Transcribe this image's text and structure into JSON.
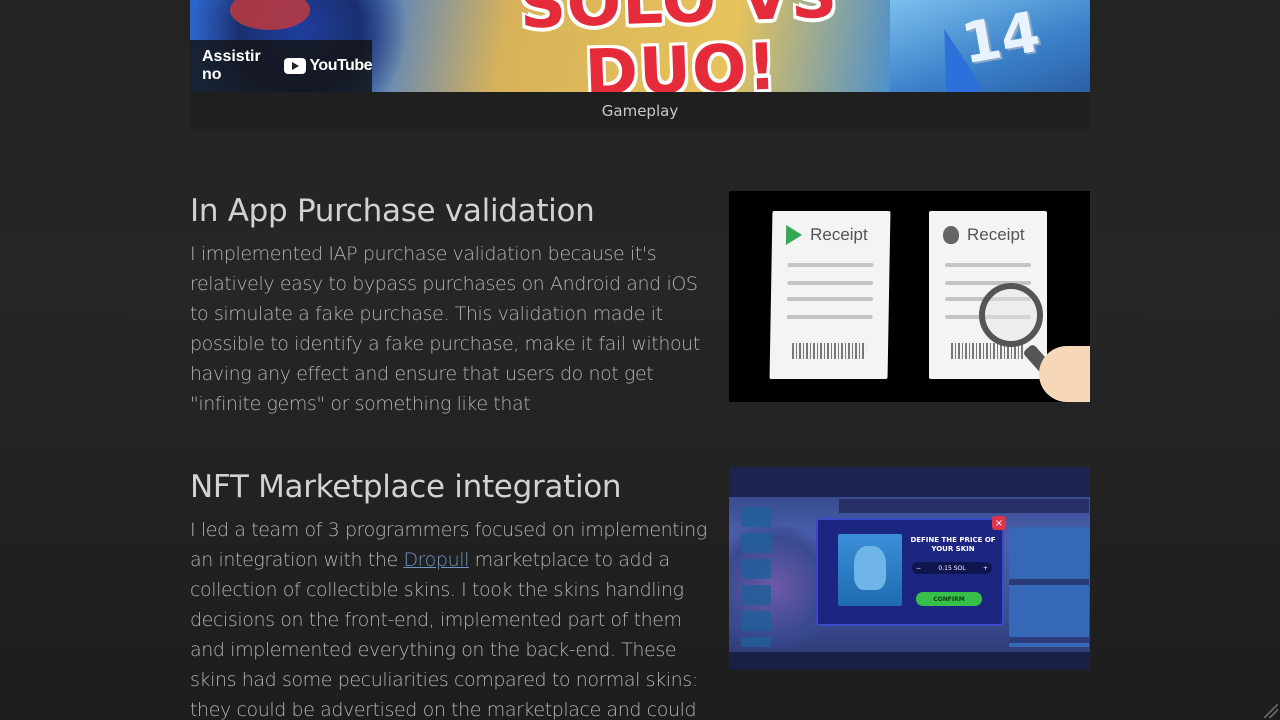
{
  "video": {
    "title_art": "SOLO VS DUO!",
    "watch_label": "Assistir no",
    "platform": "YouTube",
    "caption": "Gameplay",
    "colors": {
      "title_red": "#e52b3a",
      "overlay": "#141414"
    }
  },
  "sections": [
    {
      "heading": "In App Purchase validation",
      "body": "I implemented IAP purchase validation because it's relatively easy to bypass purchases on Android and iOS to simulate a fake purchase. This validation made it possible to identify a fake purchase, make it fail without having any effect and ensure that users do not get \"infinite gems\" or something like that",
      "image": {
        "receipt_left_label": "Receipt",
        "receipt_right_label": "Receipt",
        "icons": [
          "google-play-icon",
          "apple-icon",
          "magnifier-icon"
        ]
      }
    },
    {
      "heading": "NFT Marketplace integration",
      "body_before_link": "I led a team of 3 programmers focused on implementing an integration with the ",
      "link_text": "Dropull",
      "body_after_link": " marketplace to add a collection of collectible skins. I took the skins handling decisions on the front-end, implemented part of them and implemented everything on the back-end. These skins had some peculiarities compared to normal skins: they could be advertised on the marketplace and could be upgraded, which",
      "image": {
        "modal_title": "DEFINE THE PRICE OF YOUR SKIN",
        "price_value": "0.15 SOL",
        "confirm_label": "CONFIRM"
      }
    }
  ],
  "colors": {
    "background": "#232323",
    "link": "#6f95c2",
    "heading": "#d2d2d2",
    "body_text": "#b3b3b3"
  }
}
